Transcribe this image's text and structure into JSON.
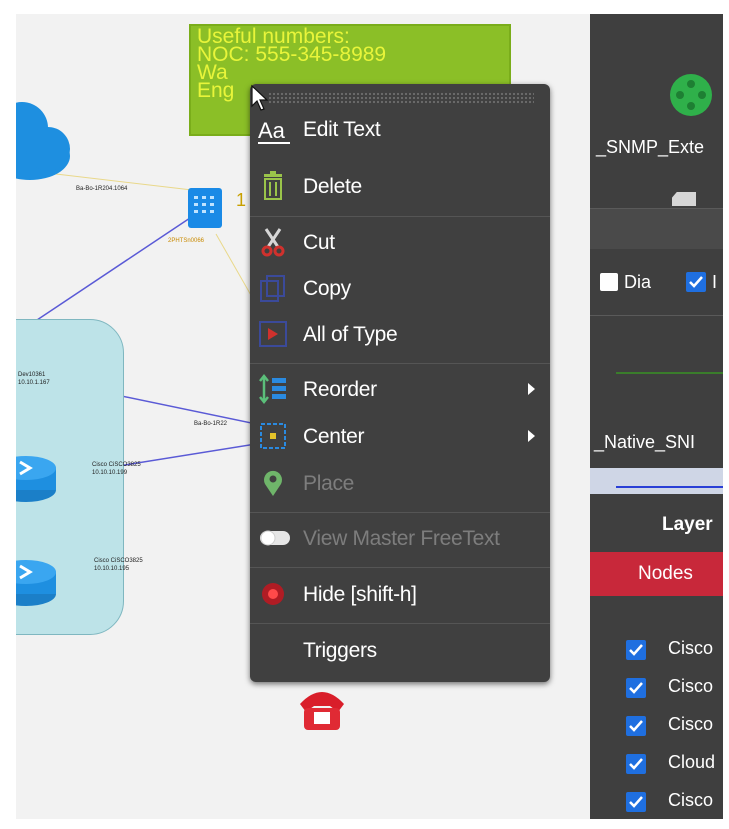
{
  "note": {
    "lines": [
      "Useful numbers:",
      "NOC: 555-345-8989",
      "Wa",
      "Eng"
    ]
  },
  "canvas": {
    "labels": {
      "link_top": "Ba-Bo-1R204.1064",
      "phone_name": "2PHTSn0066",
      "phone_num": "1",
      "dev_name": "Dev10361",
      "dev_ip": "10.10.1.167",
      "link_mid": "Ba-Bo-1R22",
      "cisco1_name": "Cisco CiSCO3825",
      "cisco1_ip": "10.10.10.199",
      "cisco2_name": "Cisco CiSCO3825",
      "cisco2_ip": "10.10.10.195"
    }
  },
  "context_menu": {
    "items": [
      {
        "label": "Edit Text",
        "icon": "text-aa-icon",
        "submenu": false,
        "enabled": true
      },
      {
        "label": "Delete",
        "icon": "trash-icon",
        "submenu": false,
        "enabled": true
      },
      {
        "label": "Cut",
        "icon": "scissors-icon",
        "submenu": false,
        "enabled": true
      },
      {
        "label": "Copy",
        "icon": "copy-icon",
        "submenu": false,
        "enabled": true
      },
      {
        "label": "All of Type",
        "icon": "select-type-icon",
        "submenu": false,
        "enabled": true
      },
      {
        "label": "Reorder",
        "icon": "reorder-icon",
        "submenu": true,
        "enabled": true
      },
      {
        "label": "Center",
        "icon": "center-icon",
        "submenu": true,
        "enabled": true
      },
      {
        "label": "Place",
        "icon": "map-pin-icon",
        "submenu": false,
        "enabled": false
      },
      {
        "label": "View Master FreeText",
        "icon": "toggle-icon",
        "submenu": false,
        "enabled": false
      },
      {
        "label": "Hide [shift-h]",
        "icon": "hide-icon",
        "submenu": false,
        "enabled": true
      },
      {
        "label": "Triggers",
        "icon": "",
        "submenu": false,
        "enabled": true
      }
    ]
  },
  "panel": {
    "snmp_ext_label": "_SNMP_Exte",
    "dia_label": "Dia",
    "second_check_label": "I",
    "native_snmp_label": "_Native_SNI",
    "layer_label": "Layer",
    "nodes_tab": "Nodes",
    "node_list": [
      "Cisco",
      "Cisco",
      "Cisco",
      "Cloud",
      "Cisco"
    ]
  },
  "colors": {
    "note_bg": "#8bbf27",
    "note_text": "#e8f53a",
    "menu_bg": "#404040",
    "panel_bg": "#3f3f3f",
    "nodes_tab_bg": "#c8283a",
    "checkbox": "#1f6fe0",
    "lan_group": "#bde3e8"
  }
}
